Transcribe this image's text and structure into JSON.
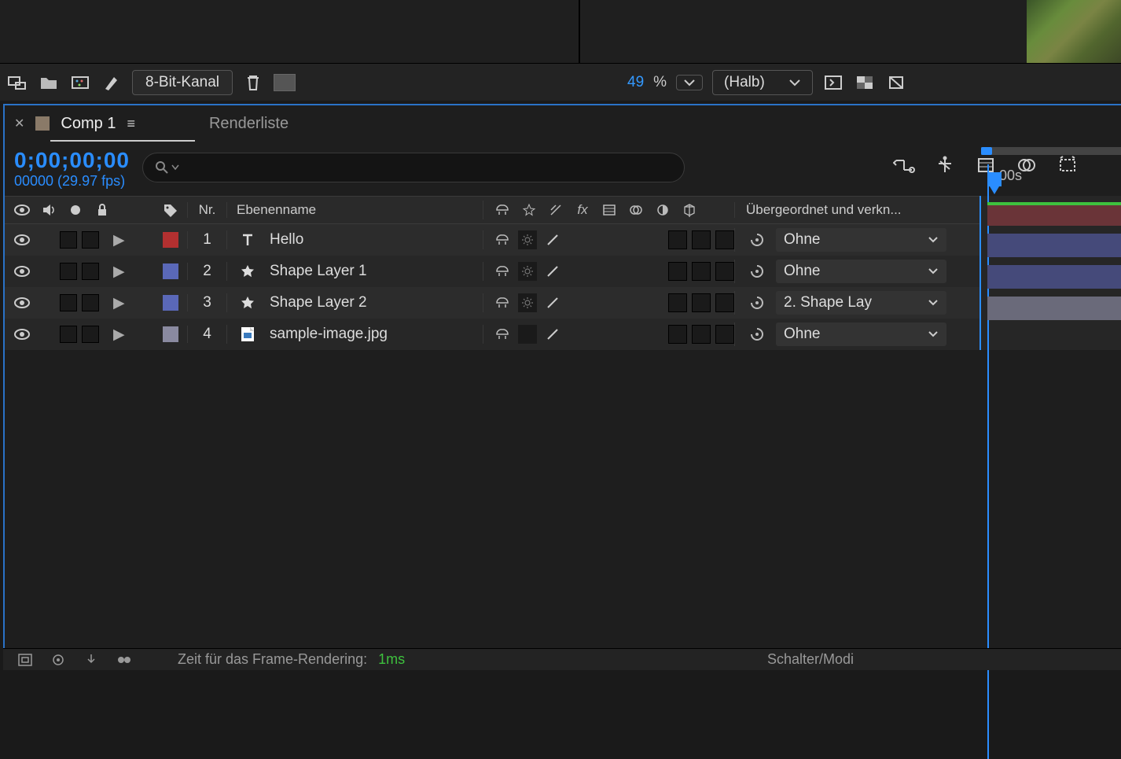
{
  "toolbar_left": {
    "bit_depth": "8-Bit-Kanal"
  },
  "toolbar_right": {
    "zoom": "49",
    "pct": "%",
    "quality": "(Halb)"
  },
  "panel": {
    "tab_title": "Comp 1",
    "tab_secondary": "Renderliste",
    "timecode": "0;00;00;00",
    "frameinfo": "00000 (29.97 fps)",
    "time_marker": ":00s"
  },
  "columns": {
    "nr": "Nr.",
    "name": "Ebenenname",
    "parent": "Übergeordnet und verkn..."
  },
  "parent_options": {
    "none": "Ohne",
    "shape1": "2. Shape Lay"
  },
  "layers": [
    {
      "nr": "1",
      "name": "Hello",
      "color": "red",
      "icon": "text",
      "parent": "Ohne"
    },
    {
      "nr": "2",
      "name": "Shape Layer 1",
      "color": "blue",
      "icon": "star",
      "parent": "Ohne"
    },
    {
      "nr": "3",
      "name": "Shape Layer 2",
      "color": "blue",
      "icon": "star",
      "parent": "2. Shape Lay"
    },
    {
      "nr": "4",
      "name": "sample-image.jpg",
      "color": "gray",
      "icon": "image",
      "parent": "Ohne"
    }
  ],
  "footer": {
    "render_label": "Zeit für das Frame-Rendering:",
    "render_val": "1ms",
    "mode": "Schalter/Modi"
  }
}
